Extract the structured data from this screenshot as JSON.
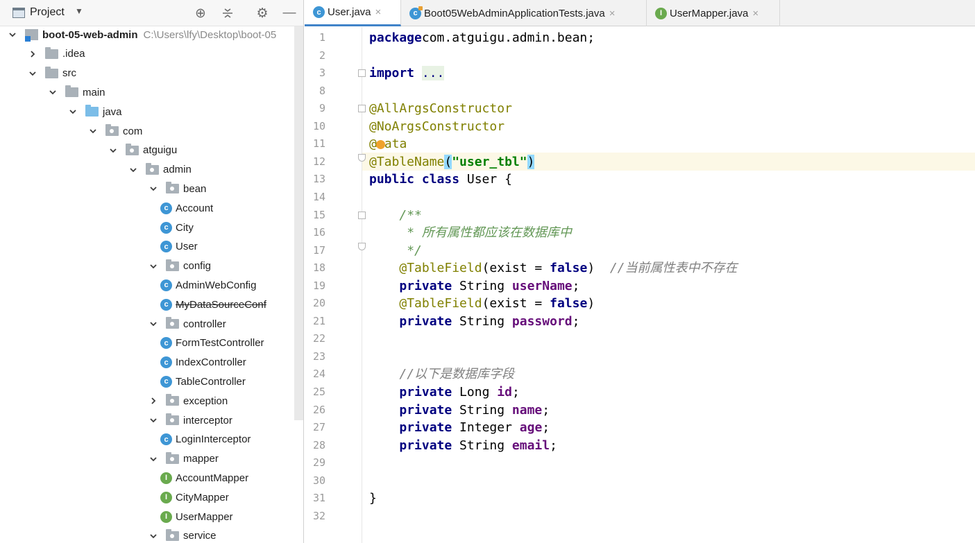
{
  "project_panel": {
    "title": "Project",
    "tree": [
      {
        "depth": 0,
        "kind": "module",
        "expand": "open",
        "label": "boot-05-web-admin",
        "path": "C:\\Users\\lfy\\Desktop\\boot-05",
        "bold": true
      },
      {
        "depth": 1,
        "kind": "folder",
        "expand": "closed",
        "label": ".idea"
      },
      {
        "depth": 1,
        "kind": "folder",
        "expand": "open",
        "label": "src"
      },
      {
        "depth": 2,
        "kind": "folder",
        "expand": "open",
        "label": "main"
      },
      {
        "depth": 3,
        "kind": "folder-blue",
        "expand": "open",
        "label": "java"
      },
      {
        "depth": 4,
        "kind": "package",
        "expand": "open",
        "label": "com"
      },
      {
        "depth": 5,
        "kind": "package",
        "expand": "open",
        "label": "atguigu"
      },
      {
        "depth": 6,
        "kind": "package",
        "expand": "open",
        "label": "admin"
      },
      {
        "depth": 7,
        "kind": "package",
        "expand": "open",
        "label": "bean"
      },
      {
        "depth": 8,
        "kind": "class",
        "label": "Account"
      },
      {
        "depth": 8,
        "kind": "class",
        "label": "City"
      },
      {
        "depth": 8,
        "kind": "class",
        "label": "User"
      },
      {
        "depth": 7,
        "kind": "package",
        "expand": "open",
        "label": "config"
      },
      {
        "depth": 8,
        "kind": "class",
        "label": "AdminWebConfig"
      },
      {
        "depth": 8,
        "kind": "class",
        "label": "MyDataSourceConf",
        "strike": true
      },
      {
        "depth": 7,
        "kind": "package",
        "expand": "open",
        "label": "controller"
      },
      {
        "depth": 8,
        "kind": "class",
        "label": "FormTestController"
      },
      {
        "depth": 8,
        "kind": "class",
        "label": "IndexController"
      },
      {
        "depth": 8,
        "kind": "class",
        "label": "TableController"
      },
      {
        "depth": 7,
        "kind": "package",
        "expand": "closed",
        "label": "exception"
      },
      {
        "depth": 7,
        "kind": "package",
        "expand": "open",
        "label": "interceptor"
      },
      {
        "depth": 8,
        "kind": "class",
        "label": "LoginInterceptor"
      },
      {
        "depth": 7,
        "kind": "package",
        "expand": "open",
        "label": "mapper"
      },
      {
        "depth": 8,
        "kind": "interface",
        "label": "AccountMapper"
      },
      {
        "depth": 8,
        "kind": "interface",
        "label": "CityMapper"
      },
      {
        "depth": 8,
        "kind": "interface",
        "label": "UserMapper"
      },
      {
        "depth": 7,
        "kind": "package",
        "expand": "open",
        "label": "service"
      }
    ]
  },
  "tabs": [
    {
      "label": "User.java",
      "icon": "class-icon",
      "active": true
    },
    {
      "label": "Boot05WebAdminApplicationTests.java",
      "icon": "test-class-icon",
      "active": false
    },
    {
      "label": "UserMapper.java",
      "icon": "interface-icon",
      "active": false
    }
  ],
  "editor": {
    "caret_line": "12",
    "lines": [
      {
        "no": "1",
        "tokens": [
          [
            "kw",
            "package"
          ],
          [
            "",
            "com.atguigu.admin.bean;"
          ]
        ]
      },
      {
        "no": "2",
        "tokens": []
      },
      {
        "no": "3",
        "tokens": [
          [
            "kw",
            "import"
          ],
          [
            "",
            " "
          ],
          [
            "fold",
            "..."
          ]
        ]
      },
      {
        "no": "8",
        "tokens": []
      },
      {
        "no": "9",
        "tokens": [
          [
            "ann",
            "@AllArgsConstructor"
          ]
        ]
      },
      {
        "no": "10",
        "tokens": [
          [
            "ann",
            "@NoArgsConstructor"
          ]
        ]
      },
      {
        "no": "11",
        "tokens": [
          [
            "ann",
            "@"
          ],
          [
            "bulb",
            ""
          ],
          [
            "ann",
            "ata"
          ]
        ]
      },
      {
        "no": "12",
        "tokens": [
          [
            "ann",
            "@TableName"
          ],
          [
            "hl",
            "("
          ],
          [
            "str",
            "\"user_tbl\""
          ],
          [
            "hl",
            ")"
          ]
        ]
      },
      {
        "no": "13",
        "tokens": [
          [
            "kw",
            "public class"
          ],
          [
            "",
            " User {"
          ]
        ]
      },
      {
        "no": "14",
        "tokens": []
      },
      {
        "no": "15",
        "tokens": [
          [
            "",
            "    "
          ],
          [
            "doc",
            "/**"
          ]
        ]
      },
      {
        "no": "16",
        "tokens": [
          [
            "",
            "     "
          ],
          [
            "doc",
            "* 所有属性都应该在数据库中"
          ]
        ]
      },
      {
        "no": "17",
        "tokens": [
          [
            "",
            "     "
          ],
          [
            "doc",
            "*/"
          ]
        ]
      },
      {
        "no": "18",
        "tokens": [
          [
            "",
            "    "
          ],
          [
            "ann",
            "@TableField"
          ],
          [
            "",
            "(exist = "
          ],
          [
            "kw",
            "false"
          ],
          [
            "",
            ")  "
          ],
          [
            "cmt",
            "//当前属性表中不存在"
          ]
        ]
      },
      {
        "no": "19",
        "tokens": [
          [
            "",
            "    "
          ],
          [
            "kw",
            "private"
          ],
          [
            "",
            " String "
          ],
          [
            "fld",
            "userName"
          ],
          [
            "",
            ";"
          ]
        ]
      },
      {
        "no": "20",
        "tokens": [
          [
            "",
            "    "
          ],
          [
            "ann",
            "@TableField"
          ],
          [
            "",
            "(exist = "
          ],
          [
            "kw",
            "false"
          ],
          [
            "",
            ")"
          ]
        ]
      },
      {
        "no": "21",
        "tokens": [
          [
            "",
            "    "
          ],
          [
            "kw",
            "private"
          ],
          [
            "",
            " String "
          ],
          [
            "fld",
            "password"
          ],
          [
            "",
            ";"
          ]
        ]
      },
      {
        "no": "22",
        "tokens": []
      },
      {
        "no": "23",
        "tokens": []
      },
      {
        "no": "24",
        "tokens": [
          [
            "",
            "    "
          ],
          [
            "cmt",
            "//以下是数据库字段"
          ]
        ]
      },
      {
        "no": "25",
        "tokens": [
          [
            "",
            "    "
          ],
          [
            "kw",
            "private"
          ],
          [
            "",
            " Long "
          ],
          [
            "fld",
            "id"
          ],
          [
            "",
            ";"
          ]
        ]
      },
      {
        "no": "26",
        "tokens": [
          [
            "",
            "    "
          ],
          [
            "kw",
            "private"
          ],
          [
            "",
            " String "
          ],
          [
            "fld",
            "name"
          ],
          [
            "",
            ";"
          ]
        ]
      },
      {
        "no": "27",
        "tokens": [
          [
            "",
            "    "
          ],
          [
            "kw",
            "private"
          ],
          [
            "",
            " Integer "
          ],
          [
            "fld",
            "age"
          ],
          [
            "",
            ";"
          ]
        ]
      },
      {
        "no": "28",
        "tokens": [
          [
            "",
            "    "
          ],
          [
            "kw",
            "private"
          ],
          [
            "",
            " String "
          ],
          [
            "fld",
            "email"
          ],
          [
            "",
            ";"
          ]
        ]
      },
      {
        "no": "29",
        "tokens": []
      },
      {
        "no": "30",
        "tokens": []
      },
      {
        "no": "31",
        "tokens": [
          [
            "",
            "}"
          ]
        ]
      },
      {
        "no": "32",
        "tokens": []
      }
    ],
    "fold_markers": [
      {
        "line": "3",
        "kind": "start"
      },
      {
        "line": "9",
        "kind": "start"
      },
      {
        "line": "12",
        "kind": "end"
      },
      {
        "line": "15",
        "kind": "start"
      },
      {
        "line": "17",
        "kind": "end"
      }
    ]
  }
}
